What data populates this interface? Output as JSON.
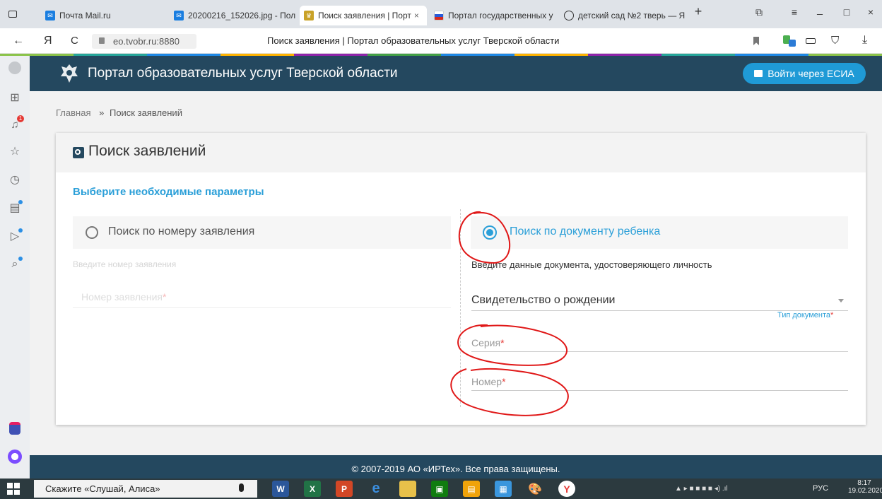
{
  "browser": {
    "tabs": [
      {
        "label": "Почта Mail.ru",
        "icon": "mail-icon"
      },
      {
        "label": "20200216_152026.jpg - Пол",
        "icon": "mail-icon"
      },
      {
        "label": "Поиск заявления | Порт",
        "icon": "coat-of-arms-icon",
        "close": "×"
      },
      {
        "label": "Портал государственных у",
        "icon": "gosuslugi-icon"
      },
      {
        "label": "детский сад №2 тверь — Я",
        "icon": "search-icon"
      }
    ],
    "new_tab": "+",
    "back": "←",
    "yandex_logo": "Я",
    "reload": "C",
    "address": "eo.tvobr.ru:8880",
    "page_title": "Поиск заявления | Портал образовательных услуг Тверской области",
    "window_controls": {
      "minimize": "_",
      "maximize": "□",
      "close": "×",
      "menu": "≡"
    }
  },
  "left_panel": {
    "icons": [
      "alice-avatar-icon",
      "apps-icon",
      "notifications-icon",
      "favorites-icon",
      "history-icon",
      "collections-icon",
      "video-icon",
      "lens-icon"
    ],
    "notification_badge": "1"
  },
  "site": {
    "title": "Портал образовательных услуг Тверской области",
    "login_button": "Войти через ЕСИА"
  },
  "breadcrumb": {
    "home": "Главная",
    "separator": "»",
    "current": "Поиск заявлений"
  },
  "card": {
    "title": "Поиск заявлений",
    "subtitle": "Выберите необходимые параметры",
    "option_number": {
      "label": "Поиск по номеру заявления",
      "hint": "Введите номер заявления",
      "field_placeholder": "Номер заявления",
      "required": "*"
    },
    "option_document": {
      "label": "Поиск по документу ребенка",
      "hint": "Введите данные документа, удостоверяющего личность",
      "doc_type_value": "Свидетельство о рождении",
      "doc_type_label": "Тип документа",
      "series_placeholder": "Серия",
      "number_placeholder": "Номер",
      "required": "*"
    }
  },
  "footer": {
    "copyright": "© 2007-2019 АО «ИРТех». Все права защищены."
  },
  "taskbar": {
    "search_placeholder": "Скажите «Слушай, Алиса»",
    "language": "РУС",
    "time": "8:17",
    "date": "19.02.2020"
  },
  "colors": {
    "header": "#24485f",
    "accent": "#2b9fd8",
    "login_button": "#1f9ad6",
    "required": "#e53935"
  }
}
